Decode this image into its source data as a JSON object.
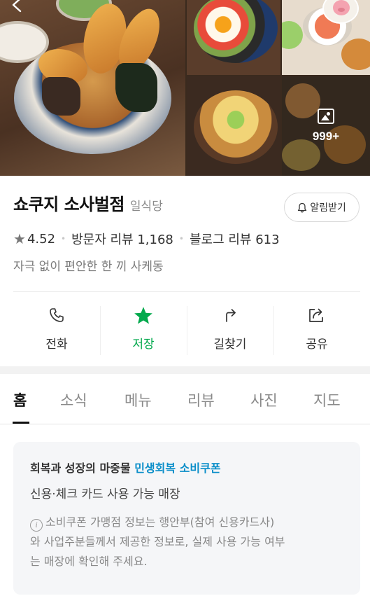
{
  "gallery": {
    "more_count": "999+",
    "images": [
      "tendon-bowl-main",
      "egg-poke-bowl",
      "side-dishes",
      "katsudon-bowl",
      "table-spread"
    ]
  },
  "place": {
    "name": "쇼쿠지 소사벌점",
    "category": "일식당",
    "alarm_label": "알림받기",
    "rating": "4.52",
    "visitor_reviews": "방문자 리뷰 1,168",
    "blog_reviews": "블로그 리뷰 613",
    "tagline": "자극 없이 편안한 한 끼 사케동"
  },
  "actions": [
    {
      "label": "전화",
      "icon": "phone-icon"
    },
    {
      "label": "저장",
      "icon": "star-icon"
    },
    {
      "label": "길찾기",
      "icon": "directions-icon"
    },
    {
      "label": "공유",
      "icon": "share-icon"
    }
  ],
  "tabs": [
    {
      "label": "홈"
    },
    {
      "label": "소식"
    },
    {
      "label": "메뉴"
    },
    {
      "label": "리뷰"
    },
    {
      "label": "사진"
    },
    {
      "label": "지도"
    }
  ],
  "coupon": {
    "title_prefix": "회복과 성장의 마중물",
    "title_highlight": "민생회복 소비쿠폰",
    "subtitle": "신용·체크 카드 사용 가능 매장",
    "note_lines": [
      "소비쿠폰 가맹점 정보는 행안부(참여 신용카드사)",
      "와 사업주분들께서 제공한 정보로, 실제 사용 가능 여부",
      "는 매장에 확인해 주세요."
    ]
  },
  "colors": {
    "accent_green": "#03a94d",
    "coupon_highlight": "#0a8ec9"
  }
}
